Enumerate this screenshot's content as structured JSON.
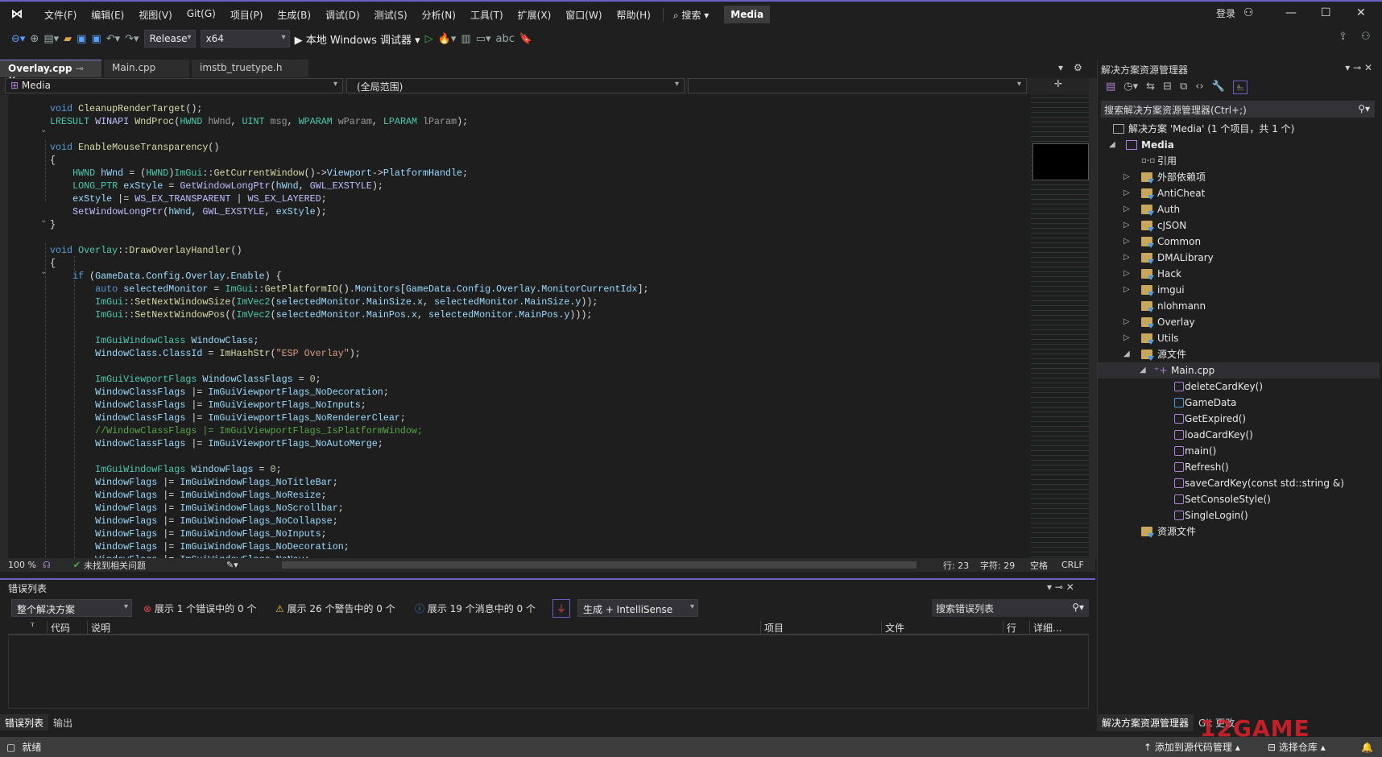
{
  "menu": {
    "items": [
      "文件(F)",
      "编辑(E)",
      "视图(V)",
      "Git(G)",
      "项目(P)",
      "生成(B)",
      "调试(D)",
      "测试(S)",
      "分析(N)",
      "工具(T)",
      "扩展(X)",
      "窗口(W)",
      "帮助(H)"
    ],
    "search": "⌕ 搜索 ▾",
    "solution_badge": "Media",
    "login": "登录"
  },
  "toolbar": {
    "config": "Release",
    "platform": "x64",
    "run": "▶ 本地 Windows 调试器 ▾"
  },
  "tabs": [
    {
      "label": "Overlay.cpp",
      "active": true
    },
    {
      "label": "Main.cpp"
    },
    {
      "label": "imstb_truetype.h"
    }
  ],
  "navbar": {
    "project": "Media",
    "scope": "(全局范围)",
    "member": ""
  },
  "code": [
    [
      [
        "k",
        "void "
      ],
      [
        "f",
        "CleanupRenderTarget"
      ],
      [
        "d",
        "();"
      ]
    ],
    [
      [
        "t",
        "LRESULT "
      ],
      [
        "m",
        "WINAPI "
      ],
      [
        "f",
        "WndProc"
      ],
      [
        "d",
        "("
      ],
      [
        "t",
        "HWND "
      ],
      [
        "p",
        "hWnd"
      ],
      [
        "d",
        ", "
      ],
      [
        "t",
        "UINT "
      ],
      [
        "p",
        "msg"
      ],
      [
        "d",
        ", "
      ],
      [
        "t",
        "WPARAM "
      ],
      [
        "p",
        "wParam"
      ],
      [
        "d",
        ", "
      ],
      [
        "t",
        "LPARAM "
      ],
      [
        "p",
        "lParam"
      ],
      [
        "d",
        ");"
      ]
    ],
    [],
    [
      [
        "k",
        "void "
      ],
      [
        "f",
        "EnableMouseTransparency"
      ],
      [
        "d",
        "()"
      ]
    ],
    [
      [
        "d",
        "{"
      ]
    ],
    [
      [
        "d",
        "    "
      ],
      [
        "t",
        "HWND "
      ],
      [
        "v",
        "hWnd"
      ],
      [
        "d",
        " = ("
      ],
      [
        "t",
        "HWND"
      ],
      [
        "d",
        ")"
      ],
      [
        "t",
        "ImGui"
      ],
      [
        "d",
        "::"
      ],
      [
        "f",
        "GetCurrentWindow"
      ],
      [
        "d",
        "()->"
      ],
      [
        "v",
        "Viewport"
      ],
      [
        "d",
        "->"
      ],
      [
        "v",
        "PlatformHandle"
      ],
      [
        "d",
        ";"
      ]
    ],
    [
      [
        "d",
        "    "
      ],
      [
        "t",
        "LONG_PTR "
      ],
      [
        "v",
        "exStyle"
      ],
      [
        "d",
        " = "
      ],
      [
        "m",
        "GetWindowLongPtr"
      ],
      [
        "d",
        "("
      ],
      [
        "v",
        "hWnd"
      ],
      [
        "d",
        ", "
      ],
      [
        "m",
        "GWL_EXSTYLE"
      ],
      [
        "d",
        ");"
      ]
    ],
    [
      [
        "d",
        "    "
      ],
      [
        "v",
        "exStyle"
      ],
      [
        "d",
        " |= "
      ],
      [
        "m",
        "WS_EX_TRANSPARENT"
      ],
      [
        "d",
        " | "
      ],
      [
        "m",
        "WS_EX_LAYERED"
      ],
      [
        "d",
        ";"
      ]
    ],
    [
      [
        "d",
        "    "
      ],
      [
        "m",
        "SetWindowLongPtr"
      ],
      [
        "d",
        "("
      ],
      [
        "v",
        "hWnd"
      ],
      [
        "d",
        ", "
      ],
      [
        "m",
        "GWL_EXSTYLE"
      ],
      [
        "d",
        ", "
      ],
      [
        "v",
        "exStyle"
      ],
      [
        "d",
        ");"
      ]
    ],
    [
      [
        "d",
        "}"
      ]
    ],
    [],
    [
      [
        "k",
        "void "
      ],
      [
        "t",
        "Overlay"
      ],
      [
        "d",
        "::"
      ],
      [
        "f",
        "DrawOverlayHandler"
      ],
      [
        "d",
        "()"
      ]
    ],
    [
      [
        "d",
        "{"
      ]
    ],
    [
      [
        "d",
        "    "
      ],
      [
        "k",
        "if "
      ],
      [
        "d",
        "("
      ],
      [
        "v",
        "GameData"
      ],
      [
        "d",
        "."
      ],
      [
        "v",
        "Config"
      ],
      [
        "d",
        "."
      ],
      [
        "v",
        "Overlay"
      ],
      [
        "d",
        "."
      ],
      [
        "v",
        "Enable"
      ],
      [
        "d",
        ") {"
      ]
    ],
    [
      [
        "d",
        "        "
      ],
      [
        "k",
        "auto "
      ],
      [
        "v",
        "selectedMonitor"
      ],
      [
        "d",
        " = "
      ],
      [
        "t",
        "ImGui"
      ],
      [
        "d",
        "::"
      ],
      [
        "f",
        "GetPlatformIO"
      ],
      [
        "d",
        "()."
      ],
      [
        "v",
        "Monitors"
      ],
      [
        "d",
        "["
      ],
      [
        "v",
        "GameData"
      ],
      [
        "d",
        "."
      ],
      [
        "v",
        "Config"
      ],
      [
        "d",
        "."
      ],
      [
        "v",
        "Overlay"
      ],
      [
        "d",
        "."
      ],
      [
        "v",
        "MonitorCurrentIdx"
      ],
      [
        "d",
        "];"
      ]
    ],
    [
      [
        "d",
        "        "
      ],
      [
        "t",
        "ImGui"
      ],
      [
        "d",
        "::"
      ],
      [
        "f",
        "SetNextWindowSize"
      ],
      [
        "d",
        "("
      ],
      [
        "t",
        "ImVec2"
      ],
      [
        "d",
        "("
      ],
      [
        "v",
        "selectedMonitor"
      ],
      [
        "d",
        "."
      ],
      [
        "v",
        "MainSize"
      ],
      [
        "d",
        "."
      ],
      [
        "v",
        "x"
      ],
      [
        "d",
        ", "
      ],
      [
        "v",
        "selectedMonitor"
      ],
      [
        "d",
        "."
      ],
      [
        "v",
        "MainSize"
      ],
      [
        "d",
        "."
      ],
      [
        "v",
        "y"
      ],
      [
        "d",
        "));"
      ]
    ],
    [
      [
        "d",
        "        "
      ],
      [
        "t",
        "ImGui"
      ],
      [
        "d",
        "::"
      ],
      [
        "f",
        "SetNextWindowPos"
      ],
      [
        "d",
        "(("
      ],
      [
        "t",
        "ImVec2"
      ],
      [
        "d",
        "("
      ],
      [
        "v",
        "selectedMonitor"
      ],
      [
        "d",
        "."
      ],
      [
        "v",
        "MainPos"
      ],
      [
        "d",
        "."
      ],
      [
        "v",
        "x"
      ],
      [
        "d",
        ", "
      ],
      [
        "v",
        "selectedMonitor"
      ],
      [
        "d",
        "."
      ],
      [
        "v",
        "MainPos"
      ],
      [
        "d",
        "."
      ],
      [
        "v",
        "y"
      ],
      [
        "d",
        ")));"
      ]
    ],
    [],
    [
      [
        "d",
        "        "
      ],
      [
        "t",
        "ImGuiWindowClass "
      ],
      [
        "v",
        "WindowClass"
      ],
      [
        "d",
        ";"
      ]
    ],
    [
      [
        "d",
        "        "
      ],
      [
        "v",
        "WindowClass"
      ],
      [
        "d",
        "."
      ],
      [
        "v",
        "ClassId"
      ],
      [
        "d",
        " = "
      ],
      [
        "f",
        "ImHashStr"
      ],
      [
        "d",
        "("
      ],
      [
        "s",
        "\"ESP Overlay\""
      ],
      [
        "d",
        ");"
      ]
    ],
    [],
    [
      [
        "d",
        "        "
      ],
      [
        "t",
        "ImGuiViewportFlags "
      ],
      [
        "v",
        "WindowClassFlags"
      ],
      [
        "d",
        " = "
      ],
      [
        "n",
        "0"
      ],
      [
        "d",
        ";"
      ]
    ],
    [
      [
        "d",
        "        "
      ],
      [
        "v",
        "WindowClassFlags"
      ],
      [
        "d",
        " |= "
      ],
      [
        "v",
        "ImGuiViewportFlags_NoDecoration"
      ],
      [
        "d",
        ";"
      ]
    ],
    [
      [
        "d",
        "        "
      ],
      [
        "v",
        "WindowClassFlags"
      ],
      [
        "d",
        " |= "
      ],
      [
        "v",
        "ImGuiViewportFlags_NoInputs"
      ],
      [
        "d",
        ";"
      ]
    ],
    [
      [
        "d",
        "        "
      ],
      [
        "v",
        "WindowClassFlags"
      ],
      [
        "d",
        " |= "
      ],
      [
        "v",
        "ImGuiViewportFlags_NoRendererClear"
      ],
      [
        "d",
        ";"
      ]
    ],
    [
      [
        "d",
        "        "
      ],
      [
        "c",
        "//WindowClassFlags |= ImGuiViewportFlags_IsPlatformWindow;"
      ]
    ],
    [
      [
        "d",
        "        "
      ],
      [
        "v",
        "WindowClassFlags"
      ],
      [
        "d",
        " |= "
      ],
      [
        "v",
        "ImGuiViewportFlags_NoAutoMerge"
      ],
      [
        "d",
        ";"
      ]
    ],
    [],
    [
      [
        "d",
        "        "
      ],
      [
        "t",
        "ImGuiWindowFlags "
      ],
      [
        "v",
        "WindowFlags"
      ],
      [
        "d",
        " = "
      ],
      [
        "n",
        "0"
      ],
      [
        "d",
        ";"
      ]
    ],
    [
      [
        "d",
        "        "
      ],
      [
        "v",
        "WindowFlags"
      ],
      [
        "d",
        " |= "
      ],
      [
        "v",
        "ImGuiWindowFlags_NoTitleBar"
      ],
      [
        "d",
        ";"
      ]
    ],
    [
      [
        "d",
        "        "
      ],
      [
        "v",
        "WindowFlags"
      ],
      [
        "d",
        " |= "
      ],
      [
        "v",
        "ImGuiWindowFlags_NoResize"
      ],
      [
        "d",
        ";"
      ]
    ],
    [
      [
        "d",
        "        "
      ],
      [
        "v",
        "WindowFlags"
      ],
      [
        "d",
        " |= "
      ],
      [
        "v",
        "ImGuiWindowFlags_NoScrollbar"
      ],
      [
        "d",
        ";"
      ]
    ],
    [
      [
        "d",
        "        "
      ],
      [
        "v",
        "WindowFlags"
      ],
      [
        "d",
        " |= "
      ],
      [
        "v",
        "ImGuiWindowFlags_NoCollapse"
      ],
      [
        "d",
        ";"
      ]
    ],
    [
      [
        "d",
        "        "
      ],
      [
        "v",
        "WindowFlags"
      ],
      [
        "d",
        " |= "
      ],
      [
        "v",
        "ImGuiWindowFlags_NoInputs"
      ],
      [
        "d",
        ";"
      ]
    ],
    [
      [
        "d",
        "        "
      ],
      [
        "v",
        "WindowFlags"
      ],
      [
        "d",
        " |= "
      ],
      [
        "v",
        "ImGuiWindowFlags_NoDecoration"
      ],
      [
        "d",
        ";"
      ]
    ],
    [
      [
        "d",
        "        "
      ],
      [
        "v",
        "WindowFlags"
      ],
      [
        "d",
        " |= "
      ],
      [
        "v",
        "ImGuiWindowFlags_NoNav"
      ],
      [
        "d",
        ";"
      ]
    ]
  ],
  "editor_status": {
    "zoom": "100 %",
    "issues": "未找到相关问题",
    "line": "行: 23",
    "char": "字符: 29",
    "spaces": "空格",
    "eol": "CRLF"
  },
  "error_list": {
    "title": "错误列表",
    "scope": "整个解决方案",
    "errors": "展示 1 个错误中的 0 个",
    "warnings": "展示 26 个警告中的 0 个",
    "messages": "展示 19 个消息中的 0 个",
    "source": "生成 + IntelliSense",
    "search_placeholder": "搜索错误列表",
    "columns": [
      "代码",
      "说明",
      "项目",
      "文件",
      "行",
      "详细..."
    ]
  },
  "bottom_tabs": [
    "错误列表",
    "输出"
  ],
  "solution_explorer": {
    "title": "解决方案资源管理器",
    "search_placeholder": "搜索解决方案资源管理器(Ctrl+;)",
    "solution": "解决方案 'Media' (1 个项目，共 1 个)",
    "project": "Media",
    "items": [
      {
        "label": "引用",
        "icon": "reference-icon",
        "arrow": ""
      },
      {
        "label": "外部依赖项",
        "icon": "external-deps-icon",
        "arrow": "▷"
      },
      {
        "label": "AntiCheat",
        "icon": "filter-folder-icon",
        "arrow": "▷"
      },
      {
        "label": "Auth",
        "icon": "filter-folder-icon",
        "arrow": "▷"
      },
      {
        "label": "cJSON",
        "icon": "filter-folder-icon",
        "arrow": "▷"
      },
      {
        "label": "Common",
        "icon": "filter-folder-icon",
        "arrow": "▷"
      },
      {
        "label": "DMALibrary",
        "icon": "filter-folder-icon",
        "arrow": "▷"
      },
      {
        "label": "Hack",
        "icon": "filter-folder-icon",
        "arrow": "▷"
      },
      {
        "label": "imgui",
        "icon": "filter-folder-icon",
        "arrow": "▷"
      },
      {
        "label": "nlohmann",
        "icon": "filter-folder-icon",
        "arrow": ""
      },
      {
        "label": "Overlay",
        "icon": "filter-folder-icon",
        "arrow": "▷"
      },
      {
        "label": "Utils",
        "icon": "filter-folder-icon",
        "arrow": "▷"
      },
      {
        "label": "源文件",
        "icon": "filter-folder-icon",
        "arrow": "◢"
      }
    ],
    "file": "Main.cpp",
    "members": [
      {
        "label": "deleteCardKey()",
        "icon": "function-icon"
      },
      {
        "label": "GameData",
        "icon": "variable-icon"
      },
      {
        "label": "GetExpired()",
        "icon": "function-icon"
      },
      {
        "label": "loadCardKey()",
        "icon": "function-icon"
      },
      {
        "label": "main()",
        "icon": "function-icon"
      },
      {
        "label": "Refresh()",
        "icon": "function-icon"
      },
      {
        "label": "saveCardKey(const std::string &)",
        "icon": "function-icon"
      },
      {
        "label": "SetConsoleStyle()",
        "icon": "function-icon"
      },
      {
        "label": "SingleLogin()",
        "icon": "function-icon"
      }
    ],
    "resources": "资源文件"
  },
  "right_tabs": [
    "解决方案资源管理器",
    "Git 更改"
  ],
  "statusbar": {
    "ready": "就绪",
    "add_source": "添加到源代码管理 ▴",
    "select_repo": "选择仓库 ▴"
  },
  "watermark": "12GAME",
  "colors": {
    "accent": "#6b5fc7",
    "keyword": "#569cd6",
    "type": "#4ec9b0",
    "function": "#dcdcaa",
    "comment": "#57a64a",
    "string": "#d69d85"
  }
}
